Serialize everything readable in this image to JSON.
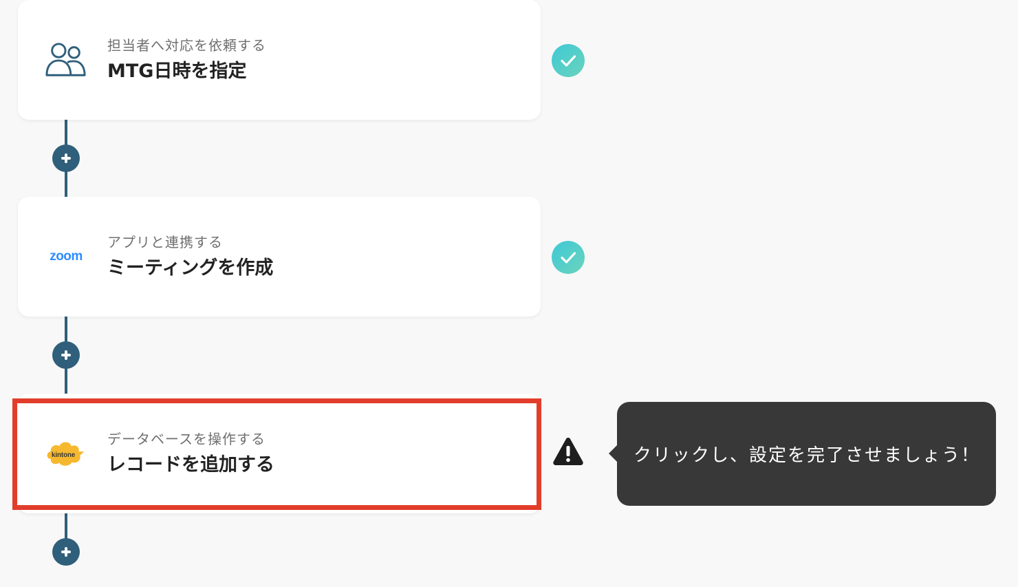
{
  "steps": [
    {
      "category": "担当者へ対応を依頼する",
      "title": "MTG日時を指定",
      "icon": "users-icon",
      "status": "complete"
    },
    {
      "category": "アプリと連携する",
      "title": "ミーティングを作成",
      "icon": "zoom-logo",
      "logo_text": "zoom",
      "status": "complete"
    },
    {
      "category": "データベースを操作する",
      "title": "レコードを追加する",
      "icon": "kintone-logo",
      "logo_text": "kintone",
      "status": "warning"
    }
  ],
  "tooltip": {
    "text": "クリックし、設定を完了させましょう！"
  },
  "colors": {
    "background": "#f8f8f8",
    "flow_line": "#2f5f7a",
    "check_gradient_start": "#3ec9d6",
    "check_gradient_end": "#6bd3bc",
    "highlight_border": "#e23d2b",
    "tooltip_bg": "#383838",
    "zoom_blue": "#2d8cff",
    "kintone_yellow": "#f5b82e"
  }
}
